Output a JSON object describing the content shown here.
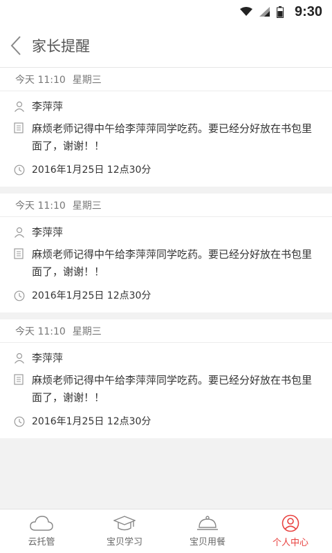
{
  "status_bar": {
    "time": "9:30"
  },
  "nav": {
    "title": "家长提醒"
  },
  "reminders": [
    {
      "date": "今天 11:10",
      "weekday": "星期三",
      "name": "李萍萍",
      "message": "麻烦老师记得中午给李萍萍同学吃药。要已经分好放在书包里面了，谢谢！！",
      "time": "2016年1月25日 12点30分"
    },
    {
      "date": "今天 11:10",
      "weekday": "星期三",
      "name": "李萍萍",
      "message": "麻烦老师记得中午给李萍萍同学吃药。要已经分好放在书包里面了，谢谢！！",
      "time": "2016年1月25日 12点30分"
    },
    {
      "date": "今天 11:10",
      "weekday": "星期三",
      "name": "李萍萍",
      "message": "麻烦老师记得中午给李萍萍同学吃药。要已经分好放在书包里面了，谢谢！！",
      "time": "2016年1月25日 12点30分"
    }
  ],
  "tabs": [
    {
      "label": "云托管",
      "icon": "cloud-icon",
      "active": false
    },
    {
      "label": "宝贝学习",
      "icon": "graduation-cap-icon",
      "active": false
    },
    {
      "label": "宝贝用餐",
      "icon": "dinner-cloche-icon",
      "active": false
    },
    {
      "label": "个人中心",
      "icon": "user-circle-icon",
      "active": true
    }
  ],
  "colors": {
    "accent": "#e8413f",
    "background": "#f2f2f2",
    "text": "#333333",
    "muted": "#777777"
  }
}
